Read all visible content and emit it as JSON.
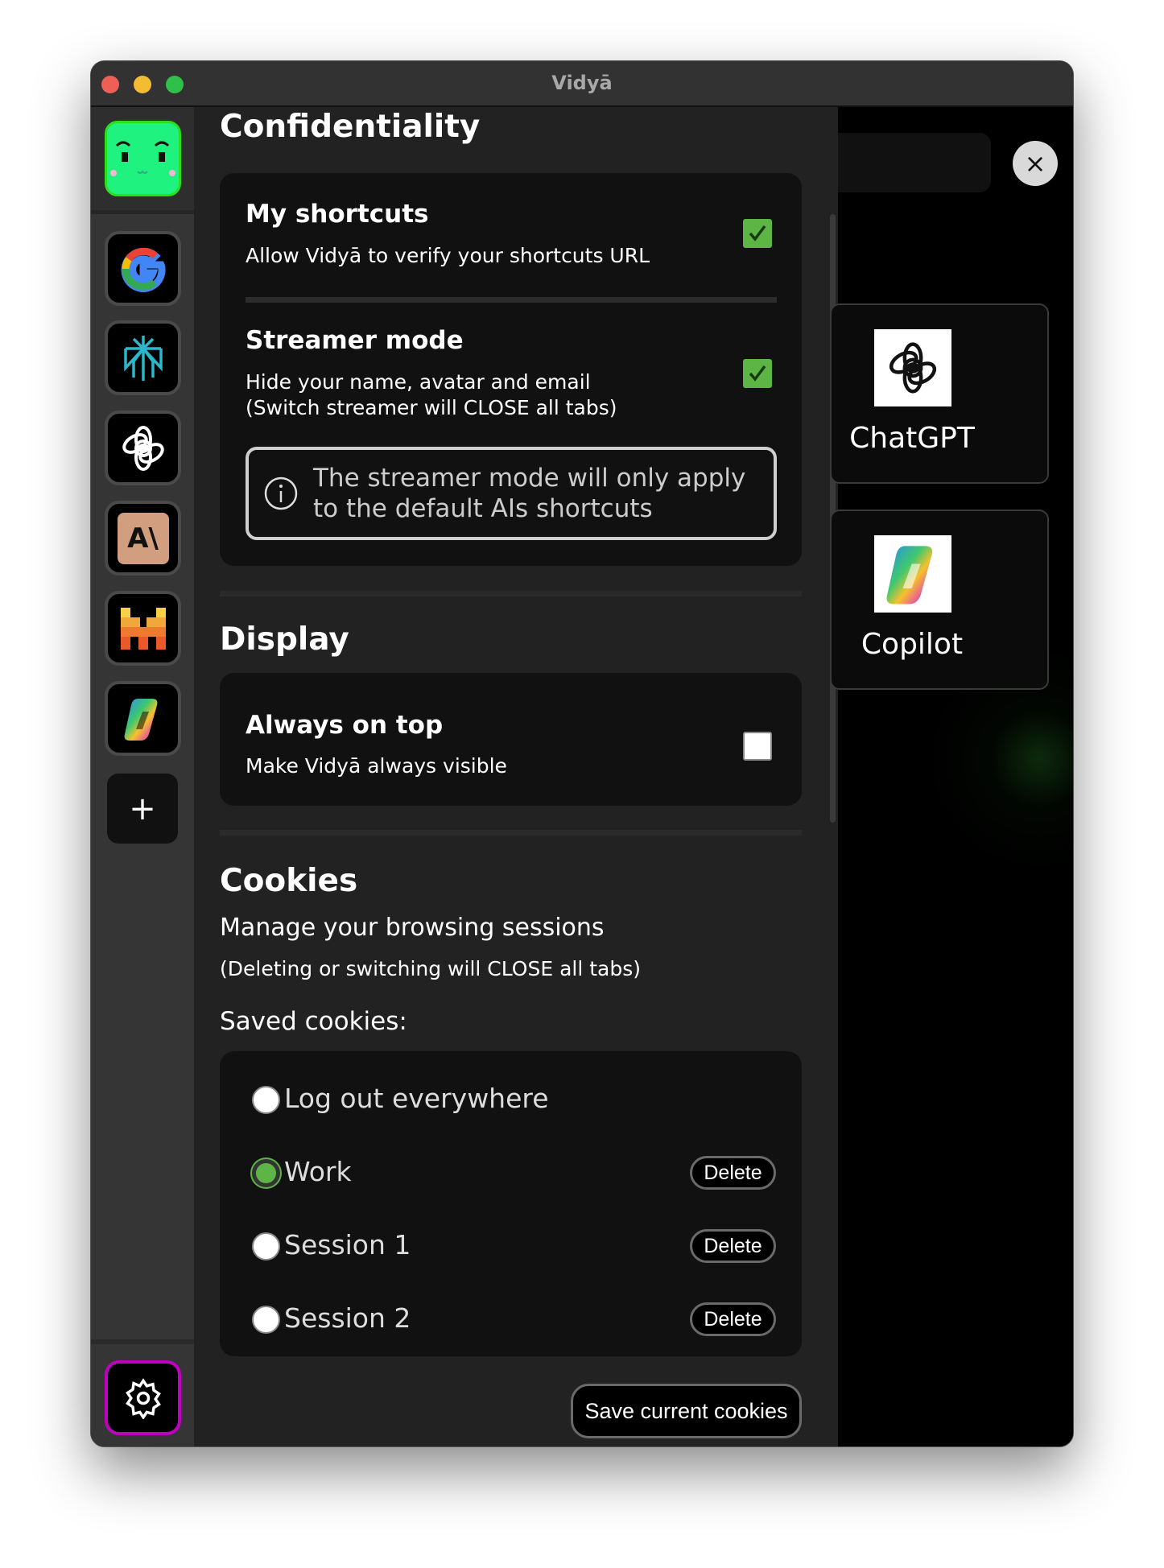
{
  "window": {
    "title": "Vidyā"
  },
  "sidebar": {
    "items": [
      {
        "name": "google",
        "icon": "google-icon"
      },
      {
        "name": "perplexity",
        "icon": "perplexity-icon"
      },
      {
        "name": "chatgpt",
        "icon": "openai-icon"
      },
      {
        "name": "claude",
        "icon": "anthropic-icon"
      },
      {
        "name": "mistral",
        "icon": "mistral-icon"
      },
      {
        "name": "copilot",
        "icon": "copilot-icon"
      }
    ],
    "add_label": "+",
    "settings_icon": "gear-icon",
    "accent": "#c000c0"
  },
  "confidentiality": {
    "heading": "Confidentiality",
    "my_shortcuts": {
      "title": "My shortcuts",
      "description": "Allow Vidyā to verify your shortcuts URL",
      "checked": true
    },
    "streamer_mode": {
      "title": "Streamer mode",
      "description_1": "Hide your name, avatar and email",
      "description_2": "(Switch streamer will CLOSE all tabs)",
      "checked": true,
      "info_1": "The streamer mode will only apply",
      "info_2": "to the default AIs shortcuts"
    }
  },
  "display": {
    "heading": "Display",
    "always_on_top": {
      "title": "Always on top",
      "description": "Make Vidyā always visible",
      "checked": false
    }
  },
  "cookies": {
    "heading": "Cookies",
    "subtitle": "Manage your browsing sessions",
    "note": "(Deleting or switching will CLOSE all tabs)",
    "saved_label": "Saved cookies:",
    "options": [
      {
        "label": "Log out everywhere",
        "selected": false
      },
      {
        "label": "Work",
        "selected": true,
        "delete": "Delete"
      },
      {
        "label": "Session 1",
        "selected": false,
        "delete": "Delete"
      },
      {
        "label": "Session 2",
        "selected": false,
        "delete": "Delete"
      }
    ],
    "save_button": "Save current cookies"
  },
  "main": {
    "cards": [
      {
        "label": "ChatGPT"
      },
      {
        "label": "Copilot"
      }
    ],
    "close_label": "×"
  },
  "colors": {
    "check": "#5cb545",
    "selected_radio": "#5cb545"
  }
}
